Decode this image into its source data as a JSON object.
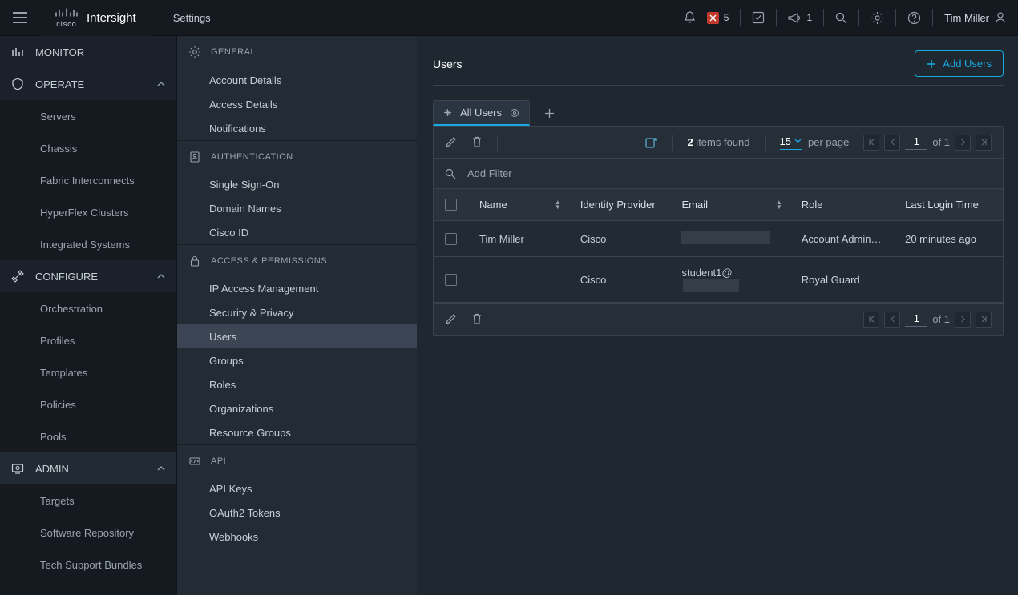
{
  "header": {
    "brand_tag": "cisco",
    "brand_name": "Intersight",
    "breadcrumb": "Settings",
    "alerts": {
      "critical_count": "5"
    },
    "announce_count": "1",
    "user_name": "Tim Miller"
  },
  "nav": {
    "monitor": "MONITOR",
    "operate": {
      "label": "OPERATE",
      "items": [
        "Servers",
        "Chassis",
        "Fabric Interconnects",
        "HyperFlex Clusters",
        "Integrated Systems"
      ]
    },
    "configure": {
      "label": "CONFIGURE",
      "items": [
        "Orchestration",
        "Profiles",
        "Templates",
        "Policies",
        "Pools"
      ]
    },
    "admin": {
      "label": "ADMIN",
      "items": [
        "Targets",
        "Software Repository",
        "Tech Support Bundles"
      ]
    }
  },
  "subnav": {
    "groups": [
      {
        "title": "GENERAL",
        "items": [
          "Account Details",
          "Access Details",
          "Notifications"
        ]
      },
      {
        "title": "AUTHENTICATION",
        "items": [
          "Single Sign-On",
          "Domain Names",
          "Cisco ID"
        ]
      },
      {
        "title": "ACCESS & PERMISSIONS",
        "items": [
          "IP Access Management",
          "Security & Privacy",
          "Users",
          "Groups",
          "Roles",
          "Organizations",
          "Resource Groups"
        ]
      },
      {
        "title": "API",
        "items": [
          "API Keys",
          "OAuth2 Tokens",
          "Webhooks"
        ]
      }
    ]
  },
  "page": {
    "title": "Users",
    "add_btn": "Add Users",
    "tab_label": "All Users"
  },
  "table": {
    "items_found_num": "2",
    "items_found_text": " items found",
    "per_page_value": "15",
    "per_page_label": "per page",
    "page_current": "1",
    "page_of": "of 1",
    "filter_placeholder": "Add Filter",
    "columns": [
      "Name",
      "Identity Provider",
      "Email",
      "Role",
      "Last Login Time"
    ],
    "rows": [
      {
        "name": "Tim Miller",
        "idp": "Cisco",
        "email": "",
        "role": "Account Administr…",
        "login": "20 minutes ago"
      },
      {
        "name": "",
        "idp": "Cisco",
        "email": "student1@",
        "role": "Royal Guard",
        "login": ""
      }
    ]
  }
}
